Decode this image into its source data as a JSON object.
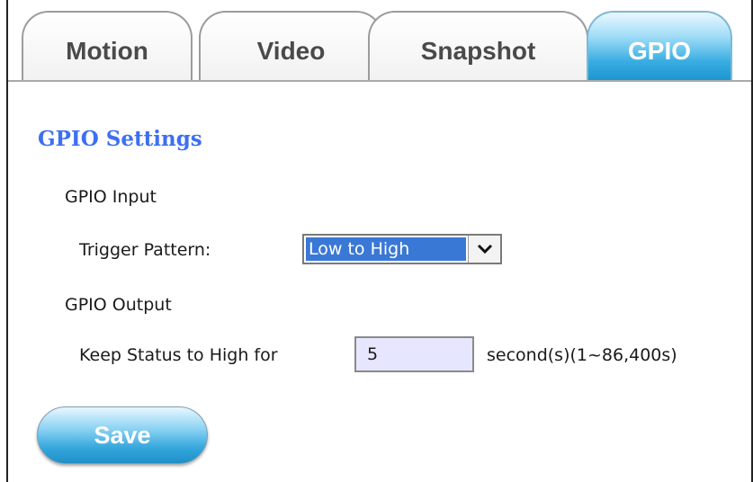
{
  "tabs": {
    "motion": "Motion",
    "video": "Video",
    "snapshot": "Snapshot",
    "gpio": "GPIO",
    "active": "gpio"
  },
  "page": {
    "heading": "GPIO Settings",
    "input_section": {
      "title": "GPIO Input",
      "trigger_pattern_label": "Trigger Pattern:",
      "trigger_pattern_value": "Low to High"
    },
    "output_section": {
      "title": "GPIO Output",
      "keep_status_label": "Keep Status to High for",
      "keep_status_value": "5",
      "keep_status_unit": "second(s)(1~86,400s)"
    },
    "save_label": "Save"
  },
  "icons": {
    "dropdown": "chevron-down-icon"
  },
  "colors": {
    "heading": "#3d6ff2",
    "active_tab": "#1a93cf",
    "selection": "#3a78d6",
    "input_bg": "#e6e6ff"
  }
}
